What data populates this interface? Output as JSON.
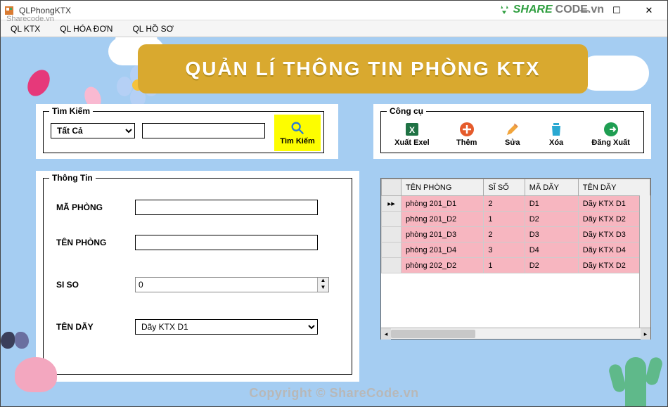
{
  "window": {
    "title": "QLPhongKTX"
  },
  "menubar": {
    "items": [
      "QL KTX",
      "QL HÓA ĐƠN",
      "QL HỒ SƠ"
    ]
  },
  "banner": {
    "title": "QUẢN LÍ THÔNG TIN PHÒNG KTX"
  },
  "search": {
    "legend": "Tìm Kiếm",
    "filter_options": [
      "Tất Cả"
    ],
    "selected_filter": "Tất Cả",
    "query": "",
    "button": "Tìm Kiếm"
  },
  "tools": {
    "legend": "Công cụ",
    "items": [
      {
        "label": "Xuất Exel",
        "icon": "excel-icon"
      },
      {
        "label": "Thêm",
        "icon": "add-icon"
      },
      {
        "label": "Sửa",
        "icon": "edit-icon"
      },
      {
        "label": "Xóa",
        "icon": "delete-icon"
      },
      {
        "label": "Đăng Xuất",
        "icon": "logout-icon"
      }
    ]
  },
  "info": {
    "legend": "Thông Tin",
    "fields": {
      "ma_phong": {
        "label": "MÃ PHÒNG",
        "value": ""
      },
      "ten_phong": {
        "label": "TÊN PHÒNG",
        "value": ""
      },
      "si_so": {
        "label": "SI SO",
        "value": "0"
      },
      "ten_day": {
        "label": "TÊN DÃY",
        "value": "Dãy KTX D1",
        "options": [
          "Dãy KTX D1"
        ]
      }
    }
  },
  "grid": {
    "columns": [
      "TÊN PHÒNG",
      "SĨ SỐ",
      "MÃ DÃY",
      "TÊN DÃY"
    ],
    "rows": [
      {
        "ten_phong": "phòng 201_D1",
        "si_so": "2",
        "ma_day": "D1",
        "ten_day": "Dãy KTX D1"
      },
      {
        "ten_phong": "phòng 201_D2",
        "si_so": "1",
        "ma_day": "D2",
        "ten_day": "Dãy KTX D2"
      },
      {
        "ten_phong": "phòng 201_D3",
        "si_so": "2",
        "ma_day": "D3",
        "ten_day": "Dãy KTX D3"
      },
      {
        "ten_phong": "phòng 201_D4",
        "si_so": "3",
        "ma_day": "D4",
        "ten_day": "Dãy KTX D4"
      },
      {
        "ten_phong": "phòng 202_D2",
        "si_so": "1",
        "ma_day": "D2",
        "ten_day": "Dãy KTX D2"
      }
    ],
    "selected_index": 0
  },
  "watermark": {
    "brand_pre": "SHARE",
    "brand_post": "CODE.vn",
    "footer": "Copyright © ShareCode.vn",
    "overlay": "Sharecode.vn"
  }
}
